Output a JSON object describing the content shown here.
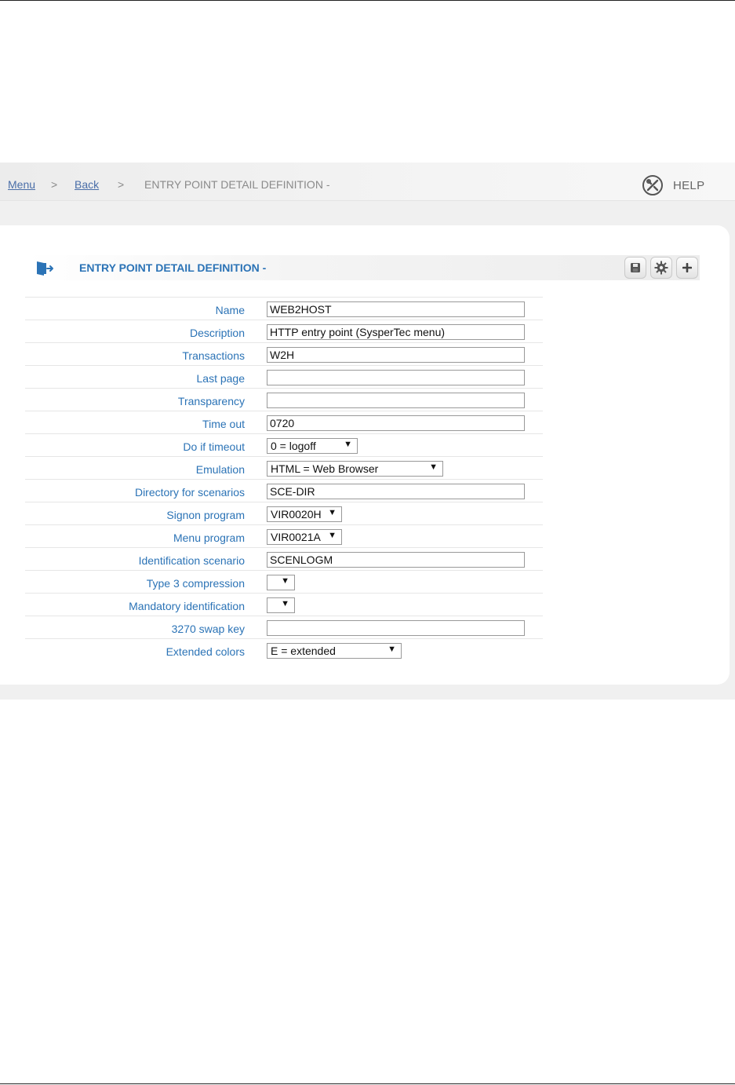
{
  "breadcrumb": {
    "menu": "Menu",
    "sep1": ">",
    "back": "Back",
    "sep2": ">",
    "current": "ENTRY POINT DETAIL DEFINITION -"
  },
  "help": {
    "label": "HELP"
  },
  "section": {
    "title": "ENTRY POINT DETAIL DEFINITION -",
    "icons": [
      "door-exit-icon",
      "save-icon",
      "gear-icon",
      "plus-icon"
    ]
  },
  "form": {
    "name": {
      "label": "Name",
      "value": "WEB2HOST"
    },
    "description": {
      "label": "Description",
      "value": "HTTP entry point (SysperTec menu)"
    },
    "transactions": {
      "label": "Transactions",
      "value": "W2H"
    },
    "last_page": {
      "label": "Last page",
      "value": ""
    },
    "transparency": {
      "label": "Transparency",
      "value": ""
    },
    "time_out": {
      "label": "Time out",
      "value": "0720"
    },
    "do_if_timeout": {
      "label": "Do if timeout",
      "value": "0 = logoff"
    },
    "emulation": {
      "label": "Emulation",
      "value": "HTML = Web Browser"
    },
    "directory": {
      "label": "Directory for scenarios",
      "value": "SCE-DIR"
    },
    "signon_program": {
      "label": "Signon program",
      "value": "VIR0020H"
    },
    "menu_program": {
      "label": "Menu program",
      "value": "VIR0021A"
    },
    "identification_scenario": {
      "label": "Identification scenario",
      "value": "SCENLOGM"
    },
    "type3_compression": {
      "label": "Type 3 compression",
      "value": ""
    },
    "mandatory_identification": {
      "label": "Mandatory identification",
      "value": ""
    },
    "swap_key": {
      "label": "3270 swap key",
      "value": ""
    },
    "extended_colors": {
      "label": "Extended colors",
      "value": "E = extended"
    }
  },
  "colors": {
    "label_blue": "#2b73b6",
    "link_blue": "#4a6ea8"
  }
}
